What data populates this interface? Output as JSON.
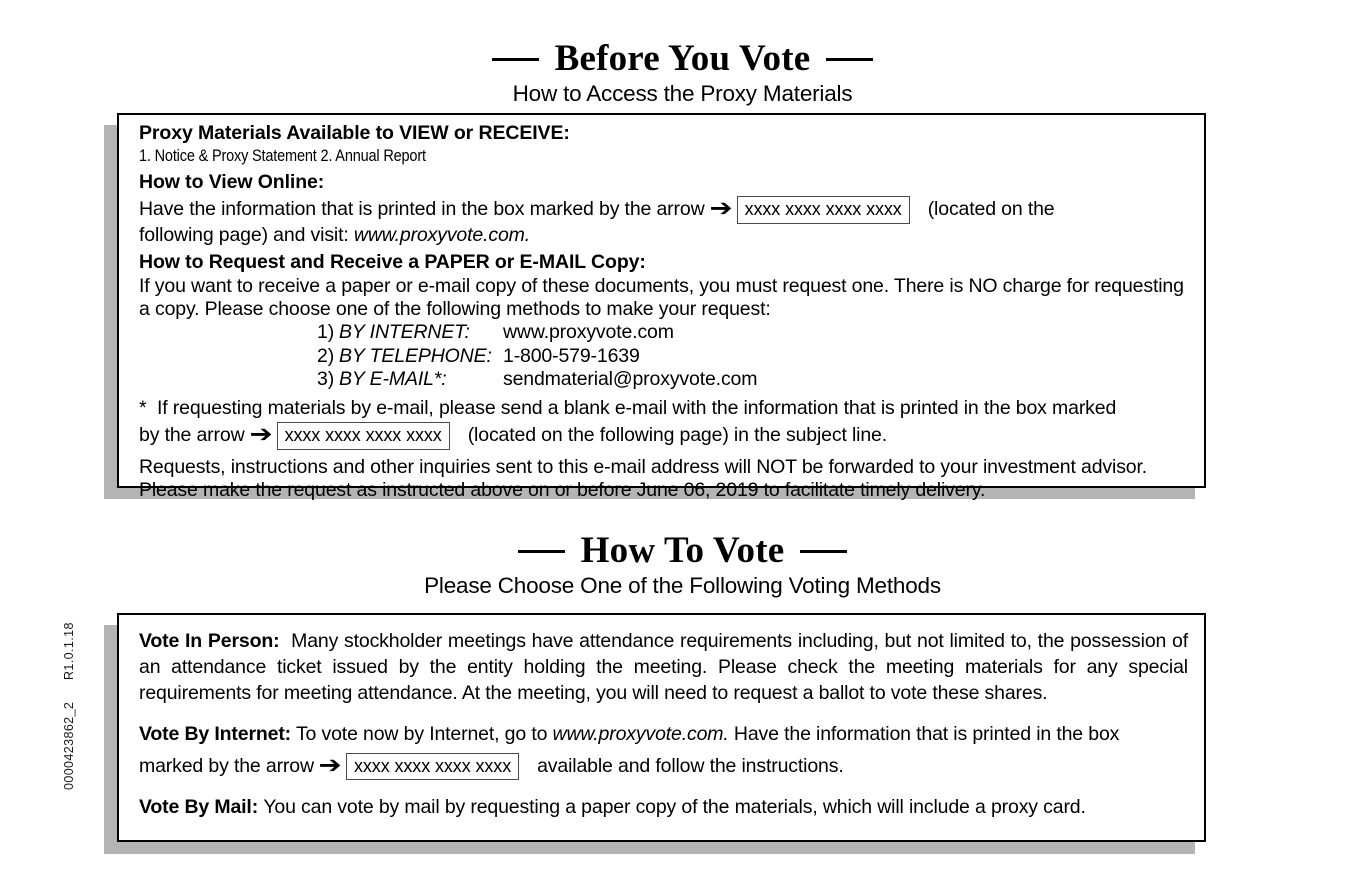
{
  "side_codes": {
    "revision": "R1.0.1.18",
    "job_number": "0000423862_2"
  },
  "section1": {
    "title": "Before You Vote",
    "subtitle": "How to Access the Proxy Materials",
    "heading_materials": "Proxy Materials Available to VIEW or RECEIVE:",
    "materials_list": "1. Notice & Proxy Statement     2. Annual Report",
    "heading_view_online": "How to View Online:",
    "view_line1_before": "Have the information that is printed in the box marked by the arrow",
    "control_number": "xxxx xxxx xxxx xxxx",
    "view_line1_after": "(located on the",
    "view_line2_plain": "following page) and visit: ",
    "view_line2_italic": "www.proxyvote.com.",
    "heading_request": "How to Request and Receive a PAPER or E-MAIL Copy:",
    "request_para": "If you want to receive a paper or e-mail copy of these documents, you must request one.  There is NO charge for requesting a copy.  Please choose one of the following methods to make your request:",
    "methods": [
      {
        "num": "1)",
        "label": "BY INTERNET:",
        "value": "www.proxyvote.com"
      },
      {
        "num": "2)",
        "label": "BY TELEPHONE:",
        "value": "1-800-579-1639"
      },
      {
        "num": "3)",
        "label": "BY E-MAIL*:",
        "value": "sendmaterial@proxyvote.com"
      }
    ],
    "footnote_marker": "*",
    "footnote_line1": "If requesting materials by e-mail, please send a blank e-mail with the information that is printed in the box marked",
    "footnote_line2_before": "by the arrow",
    "footnote_line2_after": "(located on the following page) in the subject line.",
    "closing_para": "Requests, instructions and other inquiries sent to this e-mail address will NOT be forwarded to your investment advisor. Please make the request as instructed above on or before June 06, 2019 to facilitate timely delivery."
  },
  "section2": {
    "title": "How To Vote",
    "subtitle": "Please Choose One of the Following Voting Methods",
    "in_person_label": "Vote In Person:",
    "in_person_text": "Many stockholder meetings have attendance requirements including, but not limited to, the possession of an attendance ticket issued by the entity holding the meeting. Please check the meeting materials for any special requirements for meeting attendance.  At the meeting, you will need to request a ballot to vote these shares.",
    "internet_label": "Vote By Internet:",
    "internet_text_before": "To vote now by Internet, go to ",
    "internet_url": "www.proxyvote.com.",
    "internet_text_after": "  Have the information that is printed in the box",
    "internet_line2_before": "marked by the arrow",
    "control_number": "xxxx xxxx xxxx xxxx",
    "internet_line2_after": "available and follow the instructions.",
    "mail_label": "Vote By Mail:",
    "mail_text": "You can vote by mail by requesting a paper copy of the materials, which will include a proxy card."
  },
  "icons": {
    "arrow_right": "➔"
  },
  "colors": {
    "text": "#000000",
    "shadow": "#b4b4b4",
    "box_border": "#4a4a4a"
  }
}
